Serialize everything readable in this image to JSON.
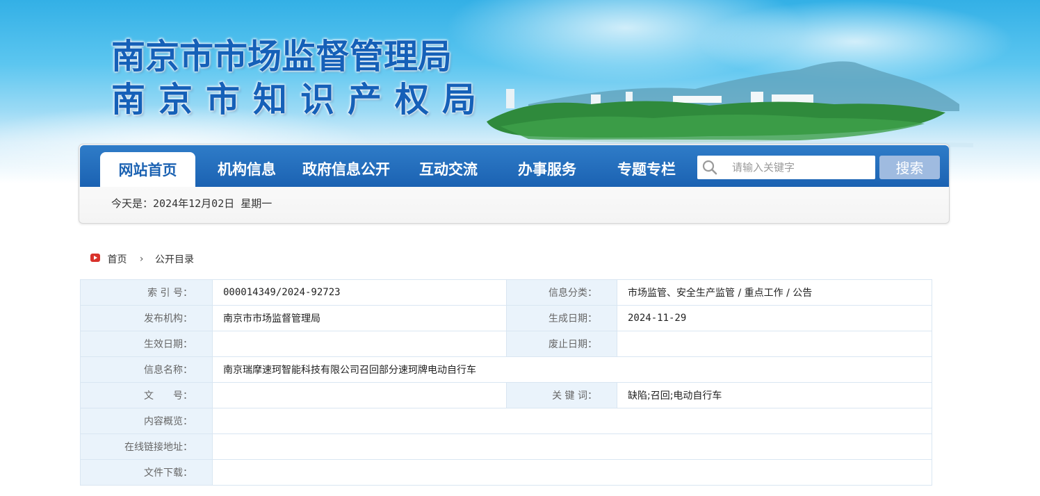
{
  "header": {
    "title_line1": "南京市市场监督管理局",
    "title_line2": "南京市知识产权局"
  },
  "nav": {
    "items": [
      {
        "label": "网站首页",
        "active": true
      },
      {
        "label": "机构信息",
        "active": false
      },
      {
        "label": "政府信息公开",
        "active": false
      },
      {
        "label": "互动交流",
        "active": false
      },
      {
        "label": "办事服务",
        "active": false
      },
      {
        "label": "专题专栏",
        "active": false
      }
    ],
    "search_placeholder": "请输入关键字",
    "search_button": "搜索",
    "date_text": "今天是：2024年12月02日 星期一"
  },
  "breadcrumb": {
    "home": "首页",
    "separator": "›",
    "current": "公开目录"
  },
  "info": {
    "index_label": "索 引 号：",
    "index_value": "000014349/2024-92723",
    "category_label": "信息分类：",
    "category_value": "市场监管、安全生产监管 / 重点工作 / 公告",
    "publisher_label": "发布机构：",
    "publisher_value": "南京市市场监督管理局",
    "created_label": "生成日期：",
    "created_value": "2024-11-29",
    "effective_label": "生效日期：",
    "effective_value": "",
    "abolished_label": "废止日期：",
    "abolished_value": "",
    "name_label": "信息名称：",
    "name_value": "南京瑞摩速珂智能科技有限公司召回部分速珂牌电动自行车",
    "docno_label": "文　　号：",
    "docno_value": "",
    "keywords_label": "关 键 词：",
    "keywords_value": "缺陷;召回;电动自行车",
    "summary_label": "内容概览：",
    "summary_value": "",
    "link_label": "在线链接地址：",
    "link_value": "",
    "download_label": "文件下载：",
    "download_value": ""
  },
  "colors": {
    "nav_blue": "#1b62b2",
    "title_blue": "#1560b8",
    "label_bg": "#eaf3fb",
    "border": "#d9e6f2",
    "home_icon_red": "#d9322b"
  },
  "icons": {
    "search": "search-icon",
    "home": "play-home-icon"
  }
}
